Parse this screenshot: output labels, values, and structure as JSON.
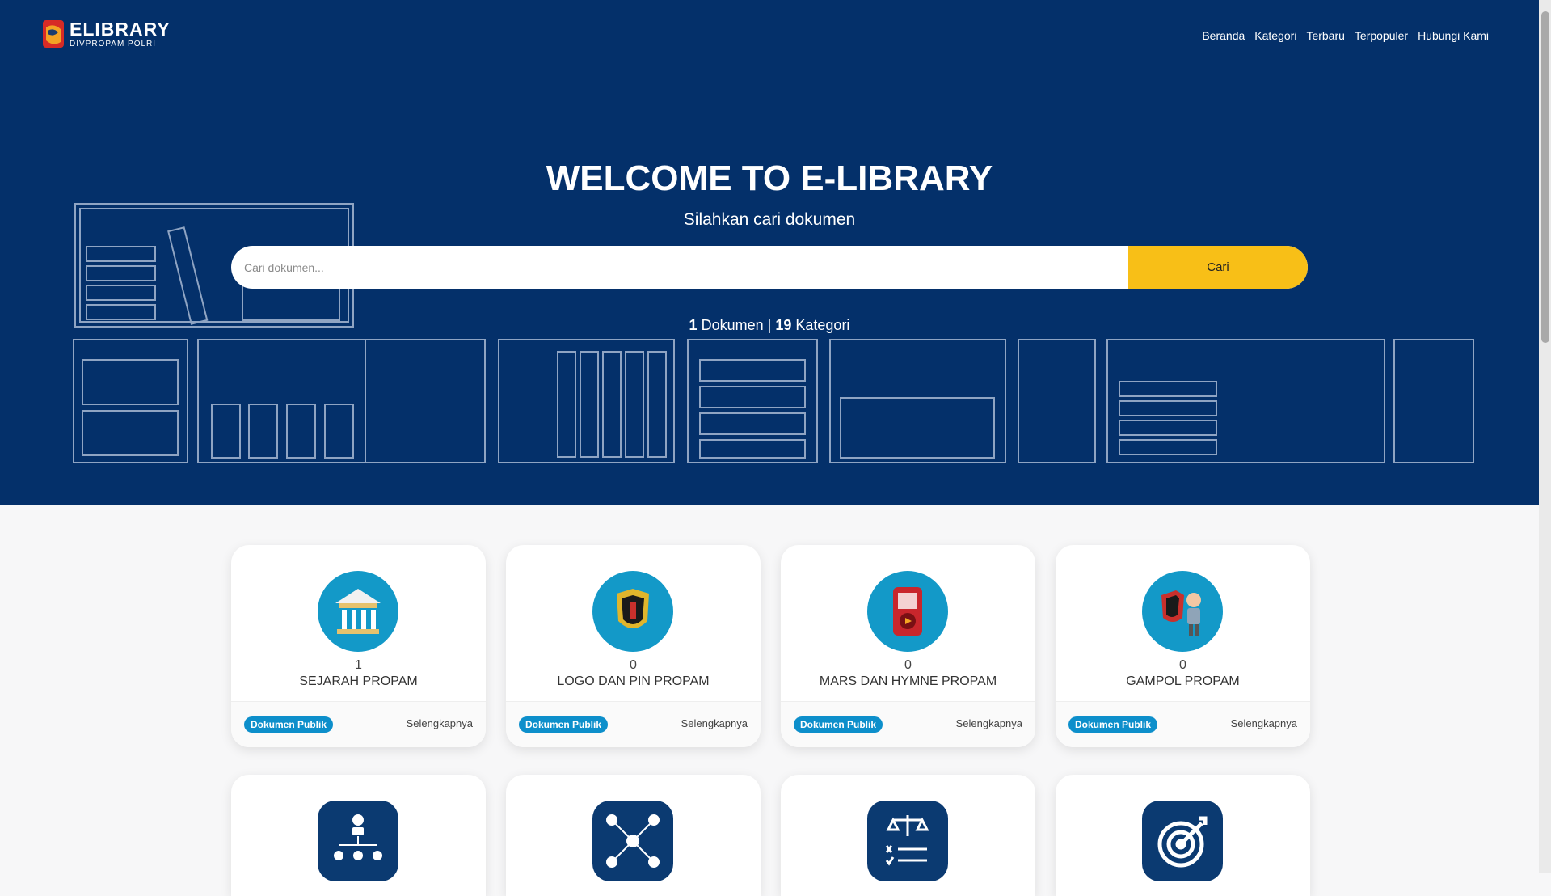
{
  "logo": {
    "line1": "ELIBRARY",
    "line2": "DIVPROPAM POLRI"
  },
  "nav": {
    "items": [
      "Beranda",
      "Kategori",
      "Terbaru",
      "Terpopuler",
      "Hubungi Kami"
    ]
  },
  "hero": {
    "title": "WELCOME TO E-LIBRARY",
    "subtitle": "Silahkan cari dokumen",
    "search_placeholder": "Cari dokumen...",
    "search_button": "Cari",
    "doc_count": "1",
    "doc_label": "Dokumen",
    "separator": "|",
    "cat_count": "19",
    "cat_label": "Kategori"
  },
  "cards": [
    {
      "count": "1",
      "name": "SEJARAH PROPAM",
      "badge": "Dokumen Publik",
      "more": "Selengkapnya",
      "icon": "museum-icon"
    },
    {
      "count": "0",
      "name": "LOGO DAN PIN PROPAM",
      "badge": "Dokumen Publik",
      "more": "Selengkapnya",
      "icon": "shield-badge-icon"
    },
    {
      "count": "0",
      "name": "MARS DAN HYMNE PROPAM",
      "badge": "Dokumen Publik",
      "more": "Selengkapnya",
      "icon": "music-player-icon"
    },
    {
      "count": "0",
      "name": "GAMPOL PROPAM",
      "badge": "Dokumen Publik",
      "more": "Selengkapnya",
      "icon": "mascot-icon"
    }
  ],
  "row2_icons": [
    "org-chart-icon",
    "network-icon",
    "justice-checklist-icon",
    "target-icon"
  ],
  "colors": {
    "navy": "#04306a",
    "accent": "#f8bf17",
    "badge": "#0d8fcb",
    "icon_blue": "#1399c8"
  }
}
